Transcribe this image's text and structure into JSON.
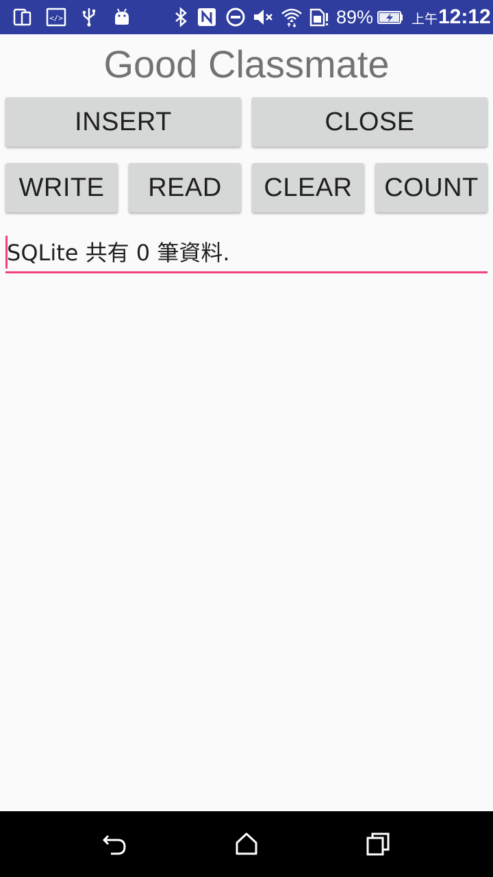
{
  "status_bar": {
    "battery_percent": "89%",
    "am_pm": "上午",
    "time": "12:12",
    "background_color": "#2f3d9e",
    "icons": [
      "screen-share-icon",
      "developer-code-icon",
      "usb-icon",
      "android-icon",
      "bluetooth-icon",
      "nfc-icon",
      "do-not-disturb-icon",
      "volume-muted-icon",
      "wifi-icon",
      "sim-alert-icon",
      "battery-charging-icon"
    ]
  },
  "app": {
    "title": "Good Classmate",
    "title_color": "#737373",
    "accent_color": "#ef3f7e"
  },
  "buttons": {
    "insert": "INSERT",
    "close": "CLOSE",
    "write": "WRITE",
    "read": "READ",
    "clear": "CLEAR",
    "count": "COUNT"
  },
  "output_field": {
    "value": "SQLite 共有 0 筆資料."
  },
  "nav_bar": {
    "icons": [
      "back-icon",
      "home-icon",
      "recents-icon"
    ]
  }
}
